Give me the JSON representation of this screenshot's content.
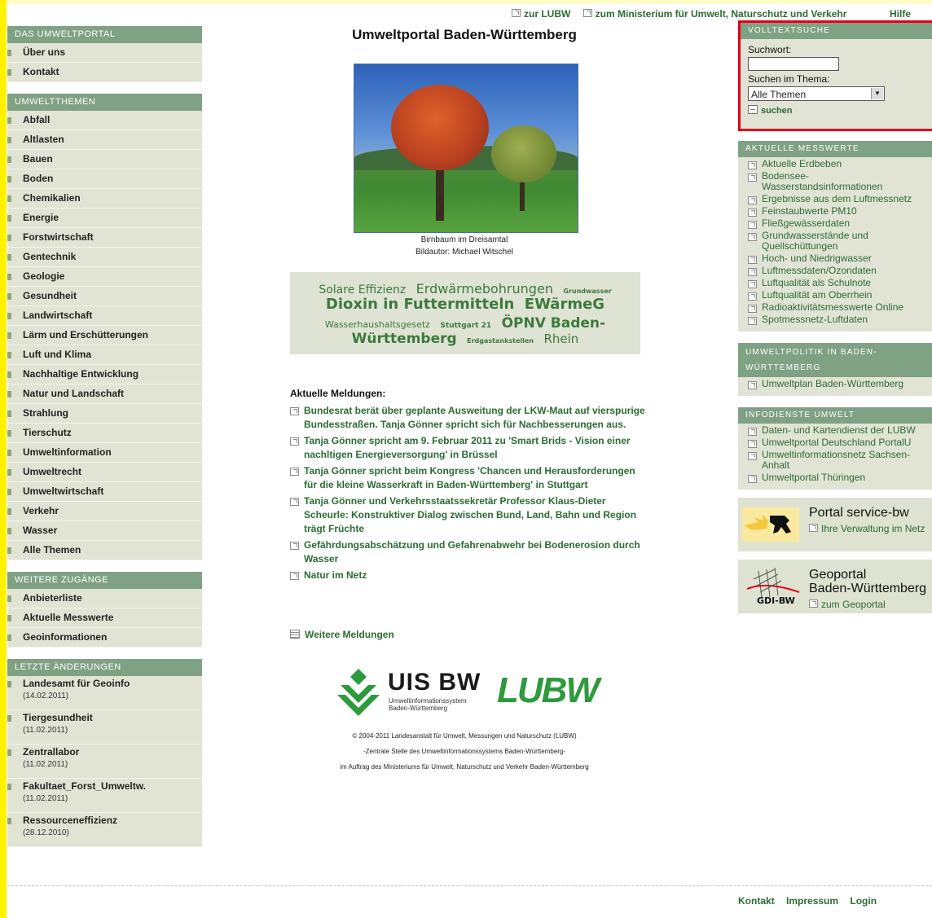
{
  "top_links": [
    "zur LUBW",
    "zum Ministerium für Umwelt, Naturschutz und Verkehr"
  ],
  "help": "Hilfe",
  "page_title": "Umweltportal Baden-Württemberg",
  "image_caption": [
    "Birnbaum im Dreisamtal",
    "Bildautor: Michael Witschel"
  ],
  "left_nav": {
    "portal": {
      "title": "DAS UMWELTPORTAL",
      "items": [
        "Über uns",
        "Kontakt"
      ]
    },
    "themes": {
      "title": "UMWELTTHEMEN",
      "items": [
        "Abfall",
        "Altlasten",
        "Bauen",
        "Boden",
        "Chemikalien",
        "Energie",
        "Forstwirtschaft",
        "Gentechnik",
        "Geologie",
        "Gesundheit",
        "Landwirtschaft",
        "Lärm und Erschütterungen",
        "Luft und Klima",
        "Nachhaltige Entwicklung",
        "Natur und Landschaft",
        "Strahlung",
        "Tierschutz",
        "Umweltinformation",
        "Umweltrecht",
        "Umweltwirtschaft",
        "Verkehr",
        "Wasser",
        "Alle Themen"
      ]
    },
    "access": {
      "title": "WEITERE ZUGÄNGE",
      "items": [
        "Anbieterliste",
        "Aktuelle Messwerte",
        "Geoinformationen"
      ]
    },
    "changes": {
      "title": "LETZTE ÄNDERUNGEN",
      "items": [
        {
          "label": "Landesamt für Geoinfo",
          "date": "(14.02.2011)"
        },
        {
          "label": "Tiergesundheit",
          "date": "(11.02.2011)"
        },
        {
          "label": "Zentrallabor",
          "date": "(11.02.2011)"
        },
        {
          "label": "Fakultaet_Forst_Umweltw.",
          "date": "(11.02.2011)"
        },
        {
          "label": "Ressourceneffizienz",
          "date": "(28.12.2010)"
        }
      ]
    }
  },
  "tagcloud": {
    "row1": [
      "Solare Effizienz",
      "Erdwärmebohrungen",
      "Grundwasser"
    ],
    "row2": [
      "Dioxin in Futtermitteln",
      "EWärmeG"
    ],
    "row3": [
      "Wasserhaushaltsgesetz",
      "Stuttgart 21",
      "ÖPNV Baden-"
    ],
    "row4": [
      "Württemberg",
      "Erdgastankstellen",
      "Rhein"
    ]
  },
  "news": {
    "heading": "Aktuelle Meldungen:",
    "items": [
      "Bundesrat berät über geplante Ausweitung der LKW-Maut auf vierspurige Bundesstraßen. Tanja Gönner spricht sich für Nachbesserungen aus.",
      "Tanja Gönner spricht am 9. Februar 2011 zu 'Smart Brids - Vision einer nachltigen Energieversorgung' in Brüssel",
      "Tanja Gönner spricht beim Kongress 'Chancen und Herausforderungen für die kleine Wasserkraft in Baden-Württemberg' in Stuttgart",
      "Tanja Gönner und Verkehrsstaatssekretär Professor Klaus-Dieter Scheurle: Konstruktiver Dialog zwischen Bund, Land, Bahn und Region trägt Früchte",
      "Gefährdungsabschätzung und Gefahrenabwehr bei Bodenerosion durch Wasser",
      "Natur im Netz"
    ],
    "more": "Weitere Meldungen"
  },
  "logos": {
    "uis_title": "UIS BW",
    "uis_sub1": "Umweltinformationssystem",
    "uis_sub2": "Baden-Württemberg",
    "lubw": "LUBW"
  },
  "copyright": [
    "© 2004-2011 Landesanstalt für Umwelt, Messungen und Naturschutz (LUBW)",
    "-Zentrale Stelle des Umweltinformationssystems Baden-Württemberg-",
    "im Auftrag des Ministeriums für Umwelt, Naturschutz und Verkehr Baden-Württemberg"
  ],
  "search": {
    "title": "VOLLTEXTSUCHE",
    "keyword_label": "Suchwort:",
    "keyword_value": "",
    "theme_label": "Suchen im Thema:",
    "theme_selected": "Alle Themen",
    "button": "suchen"
  },
  "measurements": {
    "title": "AKTUELLE MESSWERTE",
    "items": [
      "Aktuelle Erdbeben",
      "Bodensee-Wasserstandsinformationen",
      "Ergebnisse aus dem Luftmessnetz",
      "Feinstaubwerte PM10",
      "Fließgewässerdaten",
      "Grundwasserstände und Quellschüttungen",
      "Hoch- und Niedrigwasser",
      "Luftmessdaten/Ozondaten",
      "Luftqualität als Schulnote",
      "Luftqualität am Oberrhein",
      "Radioaktivitätsmesswerte Online",
      "Spotmessnetz-Luftdaten"
    ]
  },
  "policy": {
    "title": "UMWELTPOLITIK IN BADEN-WÜRTTEMBERG",
    "items": [
      "Umweltplan Baden-Württemberg"
    ]
  },
  "info": {
    "title": "INFODIENSTE UMWELT",
    "items": [
      "Daten- und Kartendienst der LUBW",
      "Umweltportal Deutschland PortalU",
      "Umweltinformationsnetz Sachsen-Anhalt",
      "Umweltportal Thüringen"
    ]
  },
  "promo_service": {
    "title": "Portal service-bw",
    "link": "Ihre Verwaltung im Netz"
  },
  "promo_geo": {
    "title1": "Geoportal",
    "title2": "Baden-Württemberg",
    "link": "zum Geoportal",
    "logo_text": "GDI-BW"
  },
  "footer": [
    "Kontakt",
    "Impressum",
    "Login"
  ]
}
